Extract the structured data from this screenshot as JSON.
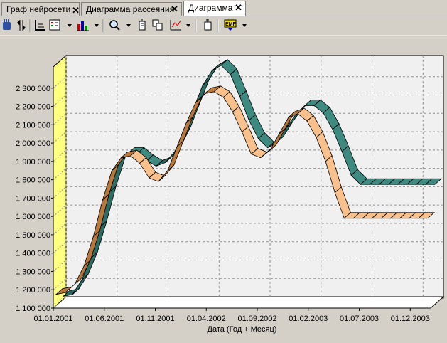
{
  "tabs": [
    {
      "label": "Граф нейросети"
    },
    {
      "label": "Диаграмма рассеяния"
    },
    {
      "label": "Диаграмма"
    }
  ],
  "toolbar_icons": [
    "hand-icon",
    "filter-icon",
    "axis-icon",
    "legend-icon",
    "bar-chart-icon",
    "zoom-icon",
    "series-icon",
    "copy-icon",
    "line-chart-icon",
    "clip-icon",
    "emf-export-icon"
  ],
  "chart_data": {
    "type": "line",
    "style": "3d-ribbon",
    "title": "",
    "xlabel": "Дата (Год + Месяц)",
    "ylabel": "",
    "ylim": [
      1100000,
      2400000
    ],
    "yticks": [
      "1 100 000",
      "1 200 000",
      "1 300 000",
      "1 400 000",
      "1 500 000",
      "1 600 000",
      "1 700 000",
      "1 800 000",
      "1 900 000",
      "2 000 000",
      "2 100 000",
      "2 200 000",
      "2 300 000"
    ],
    "xticks": [
      "01.01.2001",
      "01.06.2001",
      "01.11.2001",
      "01.04.2002",
      "01.09.2002",
      "01.02.2003",
      "01.07.2003",
      "01.12.2003"
    ],
    "x": [
      0,
      1,
      2,
      3,
      4,
      5,
      6,
      7,
      8,
      9,
      10,
      11,
      12,
      13,
      14,
      15,
      16,
      17,
      18,
      19,
      20,
      21,
      22,
      23,
      24,
      25,
      26,
      27,
      28,
      29,
      30,
      31,
      32,
      33,
      34,
      35,
      36,
      37,
      38,
      39,
      40
    ],
    "series": [
      {
        "color": "#f8c08c",
        "values": [
          1175000,
          1185000,
          1230000,
          1330000,
          1490000,
          1690000,
          1850000,
          1920000,
          1930000,
          1890000,
          1810000,
          1790000,
          1850000,
          1980000,
          2110000,
          2220000,
          2270000,
          2280000,
          2250000,
          2170000,
          2060000,
          1940000,
          1920000,
          1960000,
          2050000,
          2140000,
          2160000,
          2120000,
          2030000,
          1900000,
          1730000,
          1590000,
          1590000,
          1590000,
          1590000,
          1590000,
          1590000,
          1590000,
          1590000,
          1590000,
          1590000
        ]
      },
      {
        "color": "#3f8a80",
        "values": [
          1130000,
          1140000,
          1220000,
          1340000,
          1510000,
          1700000,
          1860000,
          1910000,
          1910000,
          1870000,
          1840000,
          1860000,
          1920000,
          2020000,
          2150000,
          2280000,
          2360000,
          2390000,
          2340000,
          2220000,
          2090000,
          1990000,
          1940000,
          1970000,
          2050000,
          2120000,
          2170000,
          2170000,
          2130000,
          2040000,
          1920000,
          1790000,
          1740000,
          1740000,
          1740000,
          1740000,
          1740000,
          1740000,
          1740000,
          1740000,
          1740000
        ]
      }
    ]
  }
}
